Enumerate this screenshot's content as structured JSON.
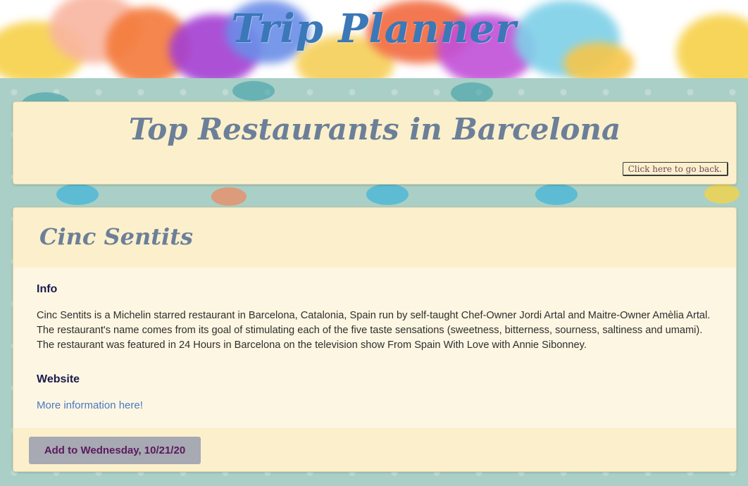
{
  "app": {
    "title": "Trip Planner"
  },
  "header": {
    "title": "Top Restaurants in Barcelona",
    "back_label": "Click here to go back."
  },
  "restaurant": {
    "name": "Cinc Sentits",
    "info_heading": "Info",
    "info_text": "Cinc Sentits is a Michelin starred restaurant in Barcelona, Catalonia, Spain run by self-taught Chef-Owner Jordi Artal and Maitre-Owner Amèlia Artal. The restaurant's name comes from its goal of stimulating each of the five taste sensations (sweetness, bitterness, sourness, saltiness and umami). The restaurant was featured in 24 Hours in Barcelona on the television show From Spain With Love with Annie Sibonney.",
    "website_heading": "Website",
    "website_link_label": "More information here!",
    "add_button_label": "Add to Wednesday, 10/21/20"
  },
  "colors": {
    "title_blue": "#3a78b8",
    "heading_slate": "#6c7f99",
    "card_cream": "#fbf0cb",
    "card_body": "#fdf6e2",
    "link_blue": "#4a78c4",
    "button_gray": "#a7a9b3",
    "button_text_purple": "#5b1a5c",
    "background_teal": "#a9cfc6"
  }
}
